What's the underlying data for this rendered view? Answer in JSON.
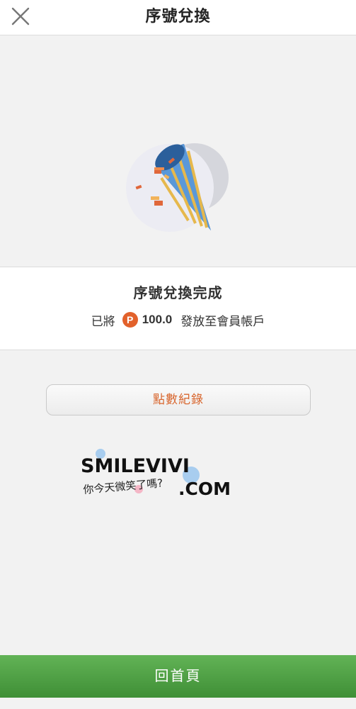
{
  "header": {
    "title": "序號兌換",
    "close_icon": "close-icon"
  },
  "hero": {
    "illustration_icon": "party-popper-icon"
  },
  "result": {
    "title": "序號兌換完成",
    "prefix": "已將",
    "point_symbol": "P",
    "amount": "100.0",
    "suffix": "發放至會員帳戶"
  },
  "actions": {
    "history_label": "點數紀錄",
    "home_label": "回首頁"
  },
  "watermark": {
    "brand": "SMILEVIVI",
    "domain": ".COM",
    "slogan": "你今天微笑了嗎?"
  },
  "colors": {
    "accent_orange": "#d8662e",
    "point_badge": "#e2612b",
    "home_green": "#4fa045"
  }
}
